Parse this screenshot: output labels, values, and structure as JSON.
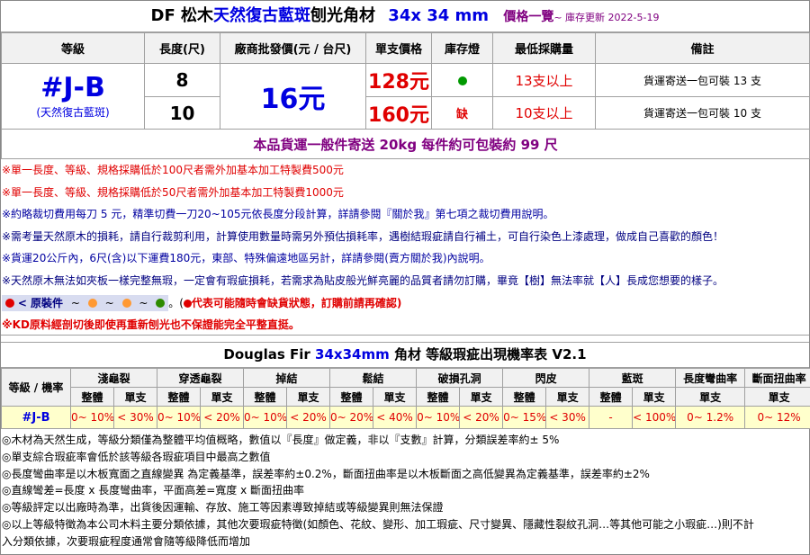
{
  "title": {
    "prefix": "DF 松木",
    "highlight": "天然復古藍斑",
    "middle": "刨光角材",
    "size": "34x 34 mm",
    "price_list": "價格一覽",
    "updated": "~ 庫存更新 2022-5-19"
  },
  "price_table": {
    "headers": [
      "等級",
      "長度(尺)",
      "廠商批發價(元 / 台尺)",
      "單支價格",
      "庫存燈",
      "最低採購量",
      "備註"
    ],
    "grade": "#J-B",
    "grade_sub": "(天然復古藍斑)",
    "wholesale": "16元",
    "rows": [
      {
        "length": "8",
        "price": "128元",
        "stock": "●",
        "stock_color": "#009900",
        "min": "13支以上",
        "remark": "貨運寄送一包可裝 13 支"
      },
      {
        "length": "10",
        "price": "160元",
        "stock": "缺",
        "stock_color": "#e00000",
        "min": "10支以上",
        "remark": "貨運寄送一包可裝 10 支"
      }
    ],
    "shipping": "本品貨運一般件寄送 20kg 每件約可包裝約 99 尺"
  },
  "notes": [
    "※單一長度、等級、規格採購低於100尺者需外加基本加工特製費500元",
    "※單一長度、等級、規格採購低於50尺者需外加基本加工特製費1000元",
    "※約略裁切費用每刀 5 元，精準切費一刀20~105元依長度分段計算，詳請參閱『關於我』第七項之裁切費用說明。",
    "※需考量天然原木的損耗，請自行裁剪利用，計算使用數量時需另外預估損耗率，遇樹結瑕疵請自行補土，可自行染色上漆處理，做成自己喜歡的顏色！",
    "※貨運20公斤內，6尺(含)以下運費180元，東部、特殊偏遠地區另計，詳請參閱(賣方關於我)內說明。",
    "※天然原木無法如夾板一樣完整無瑕，一定會有瑕疵損耗，若需求為貼皮般光鮮亮麗的品質者請勿訂購，畢竟【樹】無法率就【人】長成您想要的樣子。"
  ],
  "legend": {
    "label": "< 原裝件",
    "sep": "~",
    "colors": [
      "#e00000",
      "#ff9933",
      "#ff9933",
      "#2e8b00"
    ],
    "warning": "代表可能隨時會缺貨狀態，訂購前請再確認)",
    "warning_prefix": "(",
    "kd_note": "※KD原料經剖切後即使再重新刨光也不保證能完全平整直挺。"
  },
  "defect_table": {
    "title_prefix": "Douglas Fir",
    "title_size": "34x34mm",
    "title_suffix": "角材 等級瑕疵出現機率表 V2.1",
    "grade_label": "等級 / 機率",
    "groups": [
      "淺龜裂",
      "穿透龜裂",
      "掉結",
      "鬆結",
      "破損孔洞",
      "閃皮",
      "藍斑",
      "長度彎曲率",
      "斷面扭曲率"
    ],
    "sub_whole": "整體",
    "sub_single": "單支",
    "row_grade": "#J-B",
    "values": [
      "0~ 10%",
      "< 30%",
      "0~ 10%",
      "< 20%",
      "0~ 10%",
      "< 20%",
      "0~ 20%",
      "< 40%",
      "0~ 10%",
      "< 20%",
      "0~ 15%",
      "< 30%",
      "-",
      "< 100%",
      "0~ 1.2%",
      "0~ 12%"
    ]
  },
  "footnotes": [
    "◎木材為天然生成，等級分類僅為整體平均值概略，數值以『長度』做定義，非以『支數』計算，分類誤差率約± 5%",
    "◎單支綜合瑕疵率會低於該等級各瑕疵項目中最高之數值",
    "◎長度彎曲率是以木板寬面之直線變異 為定義基準，誤差率約±0.2%，斷面扭曲率是以木板斷面之高低變異為定義基準，誤差率約±2%",
    "◎直線彎差=長度 x 長度彎曲率，平面高差=寬度 x 斷面扭曲率",
    "◎等級評定以出廠時為準，出貨後因運輸、存放、施工等因素導致掉結或等級變異則無法保證",
    "◎以上等級特徵為本公司木料主要分類依據，其他次要瑕疵特徵(如顏色、花紋、變形、加工瑕疵、尺寸變異、隱藏性裂紋孔洞…等其他可能之小瑕疵…)則不計",
    "入分類依據，次要瑕疵程度通常會隨等級降低而增加"
  ]
}
